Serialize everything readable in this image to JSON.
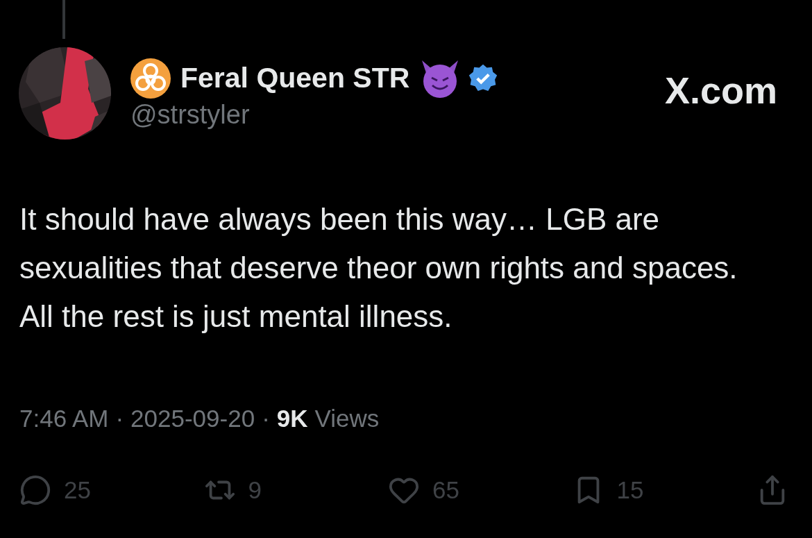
{
  "post": {
    "author": {
      "name": "Feral Queen STR",
      "handle": "@strstyler",
      "verified": true
    },
    "brand": "X.com",
    "text": "It should have always been this way… LGB are sexualities that deserve theor own rights and spaces. All the rest is just mental illness.",
    "time": "7:46 AM",
    "separator_1": "·",
    "date": "2025-09-20",
    "separator_2": "·",
    "views_count": "9K",
    "views_label": "Views",
    "actions": [
      {
        "kind": "reply",
        "count": "25"
      },
      {
        "kind": "repost",
        "count": "9"
      },
      {
        "kind": "like",
        "count": "65"
      },
      {
        "kind": "bookmark",
        "count": "15"
      },
      {
        "kind": "share"
      }
    ]
  }
}
